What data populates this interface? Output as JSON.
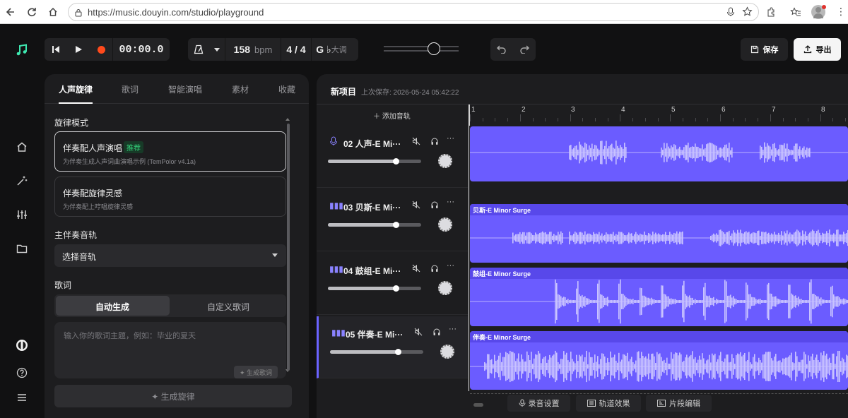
{
  "browser": {
    "url": "https://music.douyin.com/studio/playground"
  },
  "transport": {
    "time": "00:00.0"
  },
  "tempo": {
    "bpm_value": "158",
    "bpm_unit": "bpm",
    "time_signature": "4 / 4",
    "key": "G ♭",
    "key_mode": "大调"
  },
  "actions": {
    "save": "保存",
    "export": "导出"
  },
  "left_panel": {
    "tabs": [
      "人声旋律",
      "歌词",
      "智能演唱",
      "素材",
      "收藏"
    ],
    "melody_mode_title": "旋律模式",
    "modes": [
      {
        "title": "伴奏配人声演唱",
        "badge": "推荐",
        "subtitle": "为伴奏生成人声词曲演唱示例 (TemPolor v4.1a)"
      },
      {
        "title": "伴奏配旋律灵感",
        "subtitle": "为伴奏配上哼唱旋律灵感"
      }
    ],
    "main_track_title": "主伴奏音轨",
    "select_track": "选择音轨",
    "lyrics_title": "歌词",
    "lyrics_segments": [
      "自动生成",
      "自定义歌词"
    ],
    "lyrics_placeholder": "输入你的歌词主题，例如：毕业的夏天",
    "generate_lyrics": "✦ 生成歌词",
    "generate_melody": "✦ 生成旋律"
  },
  "project": {
    "title": "新项目",
    "saved": "上次保存: 2026-05-24 05:42:22",
    "add_track": "＋ 添加音轨"
  },
  "ruler": [
    "1",
    "2",
    "3",
    "4",
    "5",
    "6",
    "7",
    "8"
  ],
  "tracks": [
    {
      "name": "02 人声-E Mi···",
      "clip_label": "",
      "volume": 0.65
    },
    {
      "name": "03 贝斯-E Mi···",
      "clip_label": "贝斯-E Minor Surge",
      "volume": 0.65
    },
    {
      "name": "04 鼓组-E Mi···",
      "clip_label": "鼓组-E Minor Surge",
      "volume": 0.65
    },
    {
      "name": "05 伴奏-E Mi···",
      "clip_label": "伴奏-E Minor Surge",
      "volume": 0.65
    }
  ],
  "bottom_buttons": [
    "录音设置",
    "轨道效果",
    "片段编辑"
  ],
  "colors": {
    "accent": "#6b5cff",
    "clip_header": "#5848ea",
    "record": "#ff4a1c",
    "badge": "#34d07a"
  }
}
